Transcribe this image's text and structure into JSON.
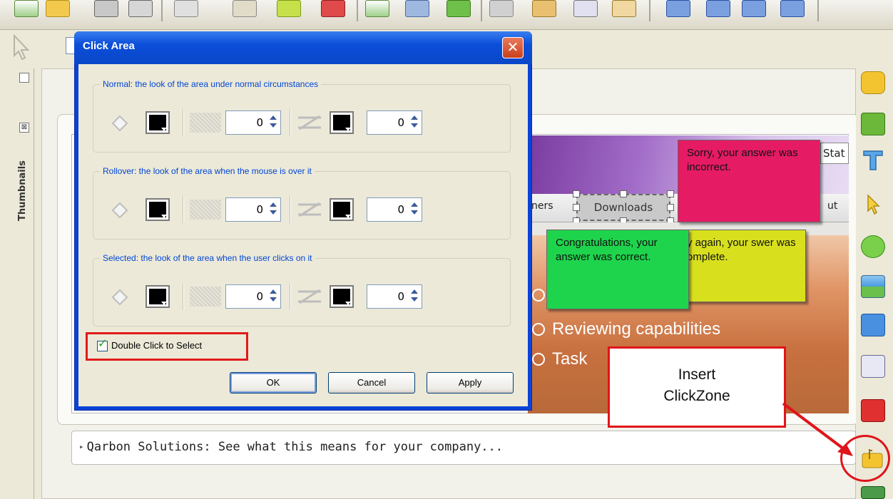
{
  "dialog": {
    "title": "Click Area",
    "close_glyph": "✕",
    "groups": [
      {
        "title": "Normal: the look of the area under normal circumstances",
        "opacity": "0",
        "line_width": "0"
      },
      {
        "title": "Rollover: the look of the area when the mouse is over it",
        "opacity": "0",
        "line_width": "0"
      },
      {
        "title": "Selected: the look of the area when the user clicks on it",
        "opacity": "0",
        "line_width": "0"
      }
    ],
    "double_click_label": "Double Click to Select",
    "double_click_checked": true,
    "check_glyph": "✓",
    "buttons": {
      "ok": "OK",
      "cancel": "Cancel",
      "apply": "Apply"
    }
  },
  "side_panel": {
    "label": "Thumbnails",
    "close_glyph": "⊠"
  },
  "slide": {
    "nav_left": "ners",
    "downloads": "Downloads",
    "nav_right": "ut",
    "stat_text": "Stat",
    "capabilities": [
      "Reviewing capabilities",
      "Task"
    ]
  },
  "callouts": {
    "sorry": "Sorry, your answer was incorrect.",
    "congrats": "Congratulations, your answer was correct.",
    "incomplete": "y again, your swer was omplete."
  },
  "info_bar": {
    "arrow": "▸",
    "text": "Qarbon Solutions: See what this means for your company..."
  },
  "annotation": {
    "line1": "Insert",
    "line2": "ClickZone"
  },
  "colors": {
    "dialog_blue": "#0b43d6",
    "group_title_blue": "#0046d5",
    "annotation_red": "#e0141a",
    "callout_pink": "#e51b64",
    "callout_green": "#1ed44c",
    "callout_yellow": "#d8e01e"
  },
  "icons": {
    "toolbar": [
      "new-slide-icon",
      "open-folder-icon",
      "save-icon",
      "print-icon",
      "cut-icon",
      "paste-icon",
      "add-icon",
      "delete-icon",
      "insert-slide-icon",
      "record-icon",
      "add-slide-green-icon",
      "shield-icon",
      "audio-icon",
      "preview-icon",
      "wand-icon",
      "first-icon",
      "prev-icon",
      "next-icon",
      "last-icon"
    ],
    "right_toolbar": [
      "speech-bubble-icon",
      "image-edit-icon",
      "text-icon",
      "pointer-icon",
      "shape-icon",
      "picture-icon",
      "ok-button-icon",
      "document-icon",
      "stop-icon",
      "click-zone-icon",
      "text-box-icon"
    ]
  }
}
